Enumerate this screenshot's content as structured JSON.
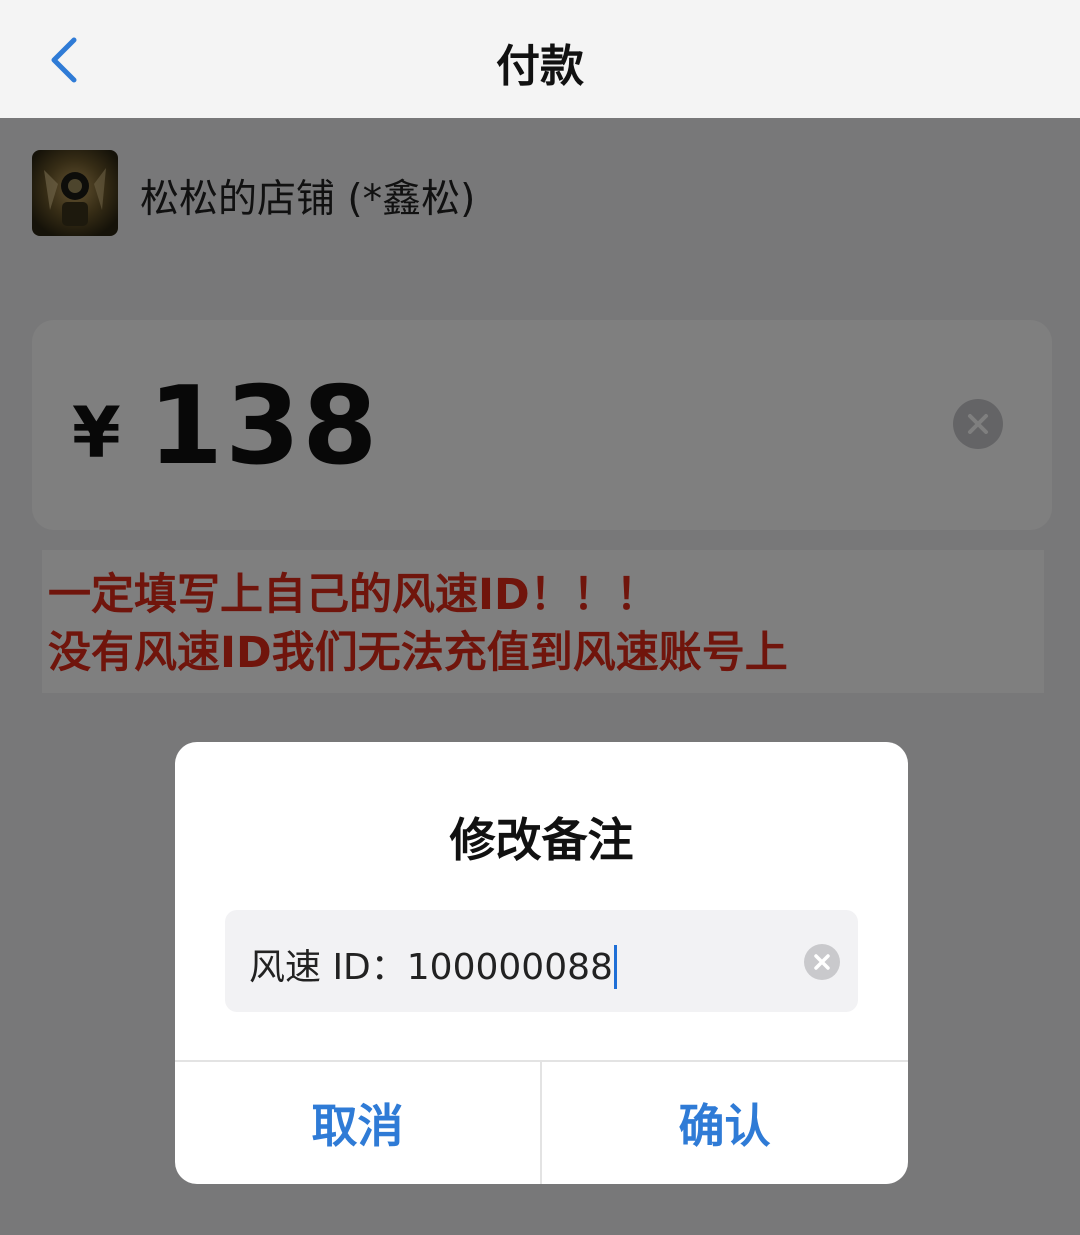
{
  "nav": {
    "title": "付款",
    "back_icon": "chevron-left-icon"
  },
  "merchant": {
    "name": "松松的店铺 (*鑫松)"
  },
  "amount": {
    "currency_symbol": "¥",
    "value": "138"
  },
  "notice": {
    "line1": "一定填写上自己的风速ID！！！",
    "line2": "没有风速ID我们无法充值到风速账号上"
  },
  "dialog": {
    "title": "修改备注",
    "input_value": "风速 ID：100000088",
    "cancel_label": "取消",
    "confirm_label": "确认"
  },
  "colors": {
    "accent": "#2f7bd6",
    "notice_red": "#e02a19",
    "overlay": "rgba(0,0,0,0.5)"
  }
}
